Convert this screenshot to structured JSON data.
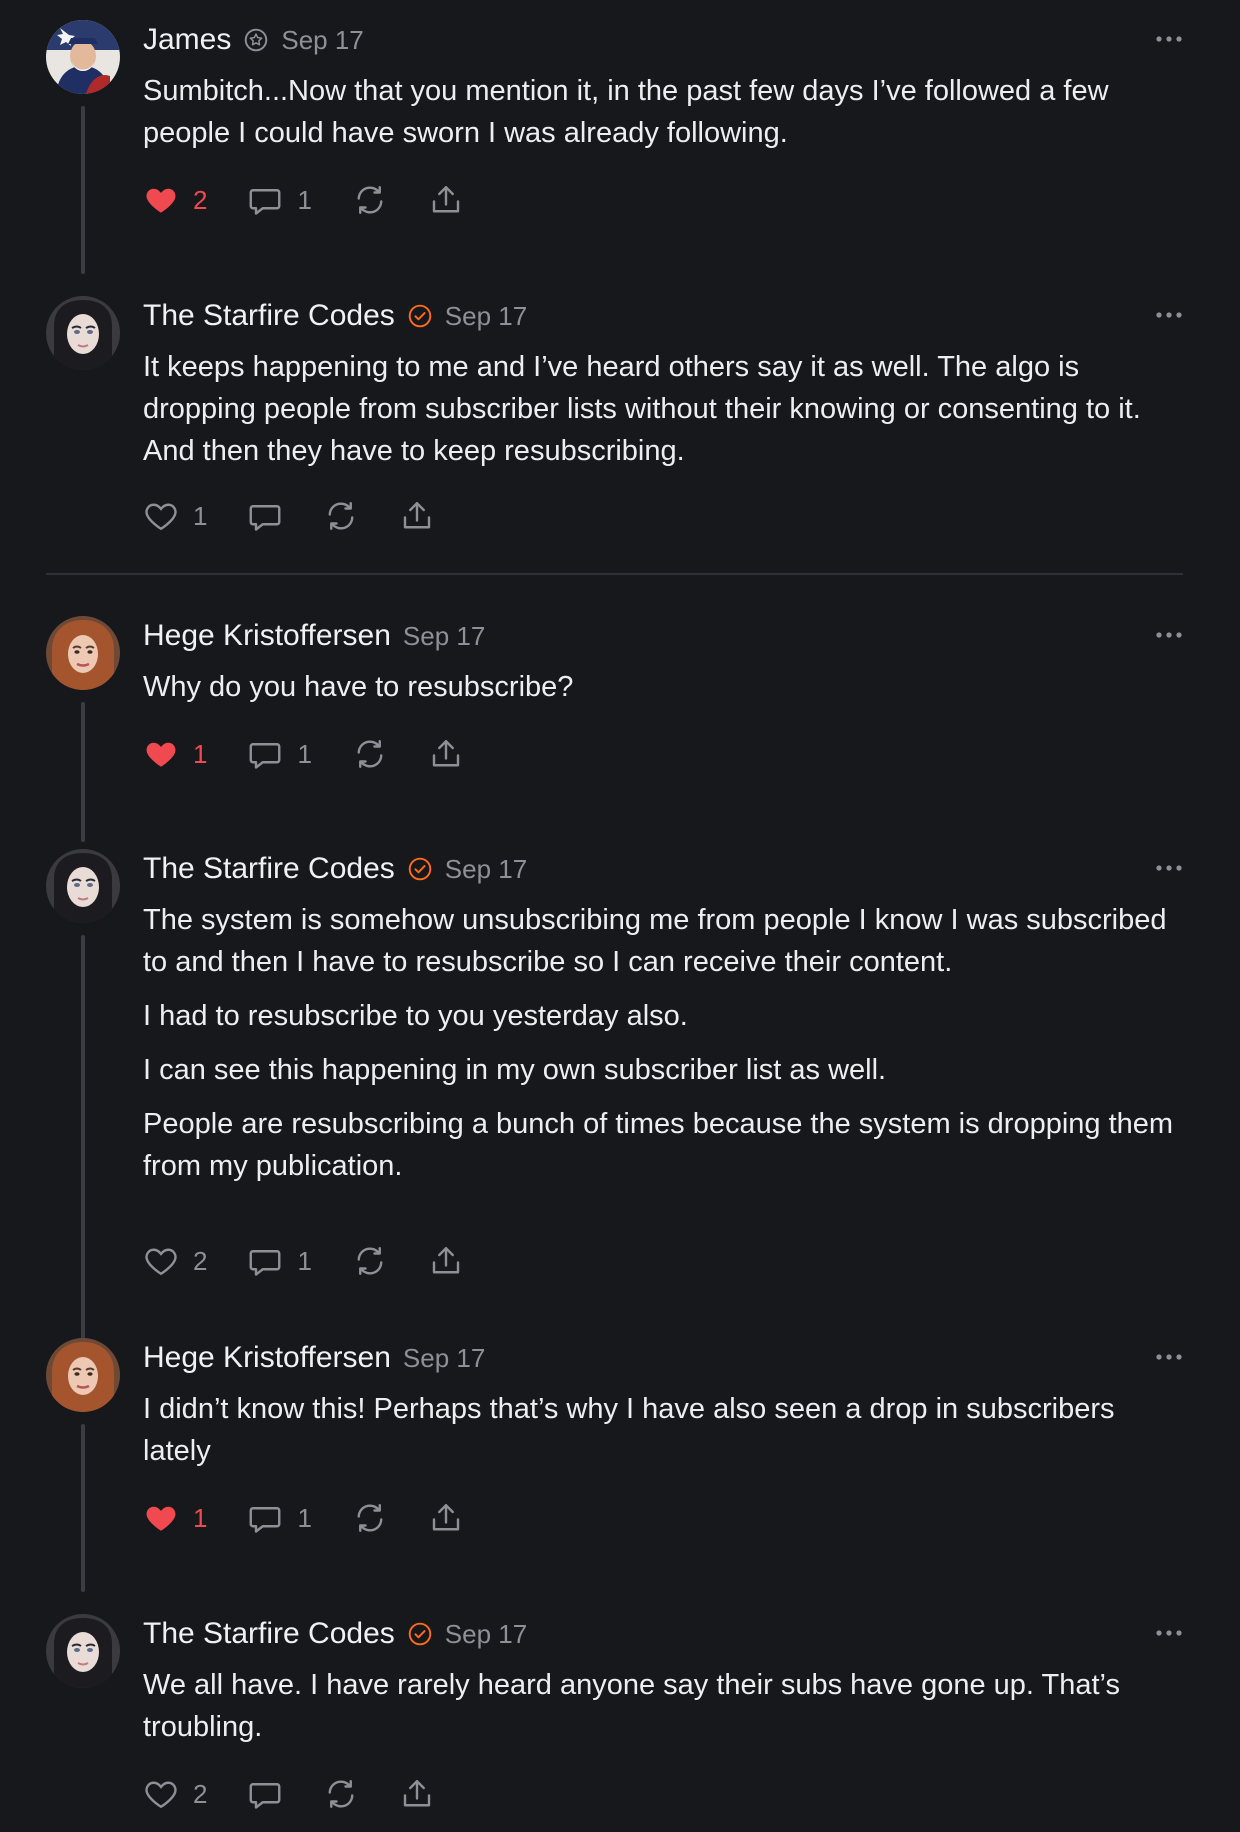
{
  "colors": {
    "background": "#16181c",
    "text": "#eceef0",
    "muted": "#8d9096",
    "liked": "#f0494f",
    "verified_badge": "#ff6b1a"
  },
  "posts": [
    {
      "author": "James",
      "badge": "subscriber-badge-icon",
      "date": "Sep 17",
      "paragraphs": [
        "Sumbitch...Now that you mention it, in the past few days I’ve followed a few people I could have sworn I was already following."
      ],
      "likes": "2",
      "liked": true,
      "comments": "1"
    },
    {
      "author": "The Starfire Codes",
      "badge": "verified-badge-icon",
      "date": "Sep 17",
      "paragraphs": [
        "It keeps happening to me and I’ve heard others say it as well. The algo is dropping people from subscriber lists without their knowing or consenting to it. And then they have to keep resubscribing."
      ],
      "likes": "1",
      "liked": false,
      "comments": ""
    },
    {
      "author": "Hege Kristoffersen",
      "badge": "",
      "date": "Sep 17",
      "paragraphs": [
        "Why do you have to resubscribe?"
      ],
      "likes": "1",
      "liked": true,
      "comments": "1"
    },
    {
      "author": "The Starfire Codes",
      "badge": "verified-badge-icon",
      "date": "Sep 17",
      "paragraphs": [
        "The system is somehow unsubscribing me from people I know I was subscribed to and then I have to resubscribe so I can receive their content.",
        "I had to resubscribe to you yesterday also.",
        "I can see this happening in my own subscriber list as well.",
        "People are resubscribing a bunch of times because the system is dropping them from my publication."
      ],
      "likes": "2",
      "liked": false,
      "comments": "1"
    },
    {
      "author": "Hege Kristoffersen",
      "badge": "",
      "date": "Sep 17",
      "paragraphs": [
        "I didn’t know this! Perhaps that’s why I have also seen a drop in subscribers lately"
      ],
      "likes": "1",
      "liked": true,
      "comments": "1"
    },
    {
      "author": "The Starfire Codes",
      "badge": "verified-badge-icon",
      "date": "Sep 17",
      "paragraphs": [
        "We all have. I have rarely heard anyone say their subs have gone up. That’s troubling."
      ],
      "likes": "2",
      "liked": false,
      "comments": ""
    }
  ]
}
